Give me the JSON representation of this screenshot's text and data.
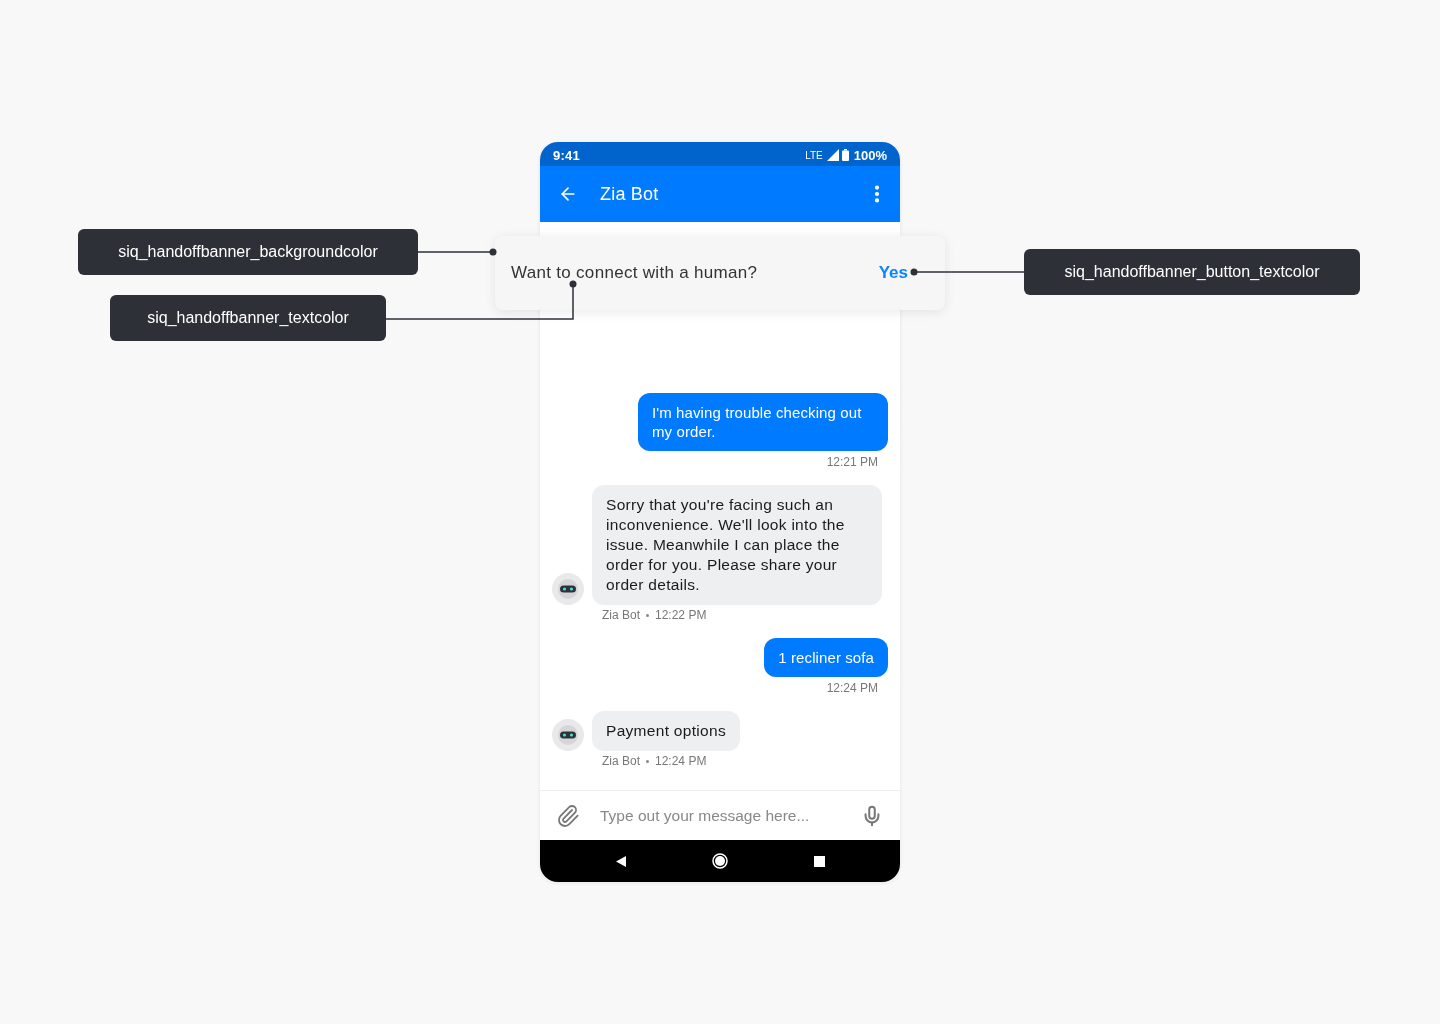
{
  "status_bar": {
    "time": "9:41",
    "network": "LTE",
    "battery": "100%"
  },
  "app_bar": {
    "title": "Zia Bot"
  },
  "handoff_banner": {
    "text": "Want to connect with a human?",
    "button": "Yes"
  },
  "messages": [
    {
      "kind": "outgoing",
      "text": "I'm having trouble checking out my order.",
      "time": "12:21 PM"
    },
    {
      "kind": "incoming",
      "text": "Sorry that you're facing such an inconvenience. We'll look into the issue. Meanwhile I can place the order for you. Please share your order details.",
      "sender": "Zia Bot",
      "time": "12:22 PM"
    },
    {
      "kind": "outgoing",
      "text": "1 recliner sofa",
      "time": "12:24 PM"
    },
    {
      "kind": "incoming",
      "text": "Payment options",
      "sender": "Zia Bot",
      "time": "12:24 PM"
    }
  ],
  "composer": {
    "placeholder": "Type out your message here..."
  },
  "annotations": [
    {
      "label": "siq_handoffbanner_backgroundcolor",
      "kind": "background"
    },
    {
      "label": "siq_handoffbanner_textcolor",
      "kind": "text"
    },
    {
      "label": "siq_handoffbanner_button_textcolor",
      "kind": "button"
    }
  ]
}
